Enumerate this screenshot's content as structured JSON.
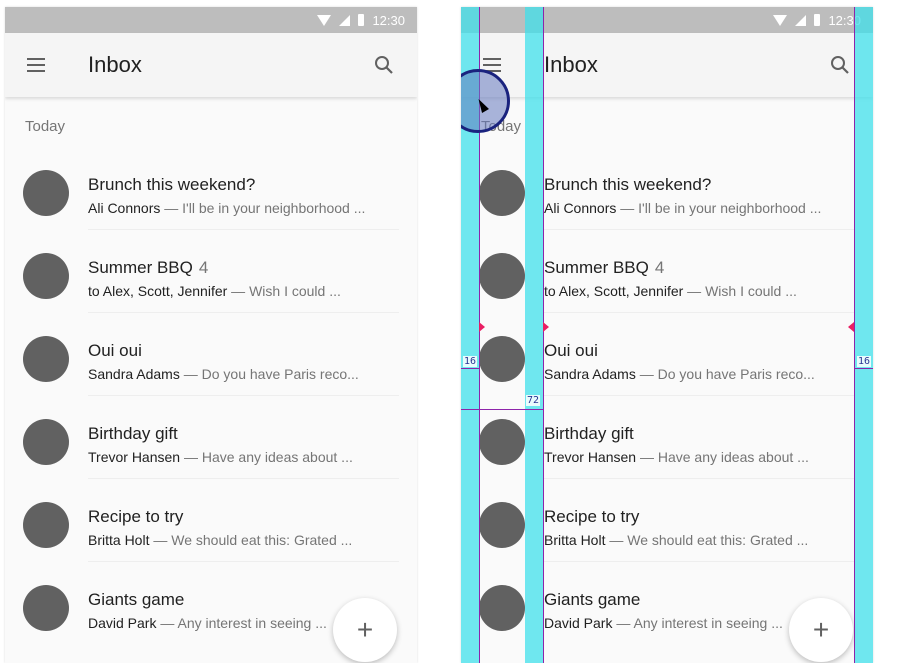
{
  "status_bar": {
    "time": "12:30"
  },
  "app_bar": {
    "title": "Inbox"
  },
  "section_header": "Today",
  "messages": [
    {
      "subject": "Brunch this weekend?",
      "count": "",
      "sender": "Ali Connors",
      "preview": " — I'll be in your neighborhood ..."
    },
    {
      "subject": "Summer BBQ",
      "count": "4",
      "sender": "to Alex, Scott, Jennifer",
      "preview": " — Wish I could ..."
    },
    {
      "subject": "Oui oui",
      "count": "",
      "sender": "Sandra Adams",
      "preview": " — Do you have Paris reco..."
    },
    {
      "subject": "Birthday gift",
      "count": "",
      "sender": "Trevor Hansen",
      "preview": " — Have any ideas about ..."
    },
    {
      "subject": "Recipe to try",
      "count": "",
      "sender": "Britta Holt",
      "preview": " — We should eat this: Grated ..."
    },
    {
      "subject": "Giants game",
      "count": "",
      "sender": "David Park",
      "preview": " — Any interest in seeing ..."
    }
  ],
  "fab": {
    "label": "+"
  },
  "keyline_overlay": {
    "left_margin_label": "16",
    "right_margin_label": "16",
    "content_keyline_label": "72",
    "colors": {
      "keyline": "#40e0eb",
      "guide": "#8e24aa",
      "marker": "#e91e63"
    }
  },
  "colors": {
    "status_bar": "#bdbdbd",
    "app_bar": "#f5f5f5",
    "avatar": "#616161",
    "background": "#fafafa"
  }
}
